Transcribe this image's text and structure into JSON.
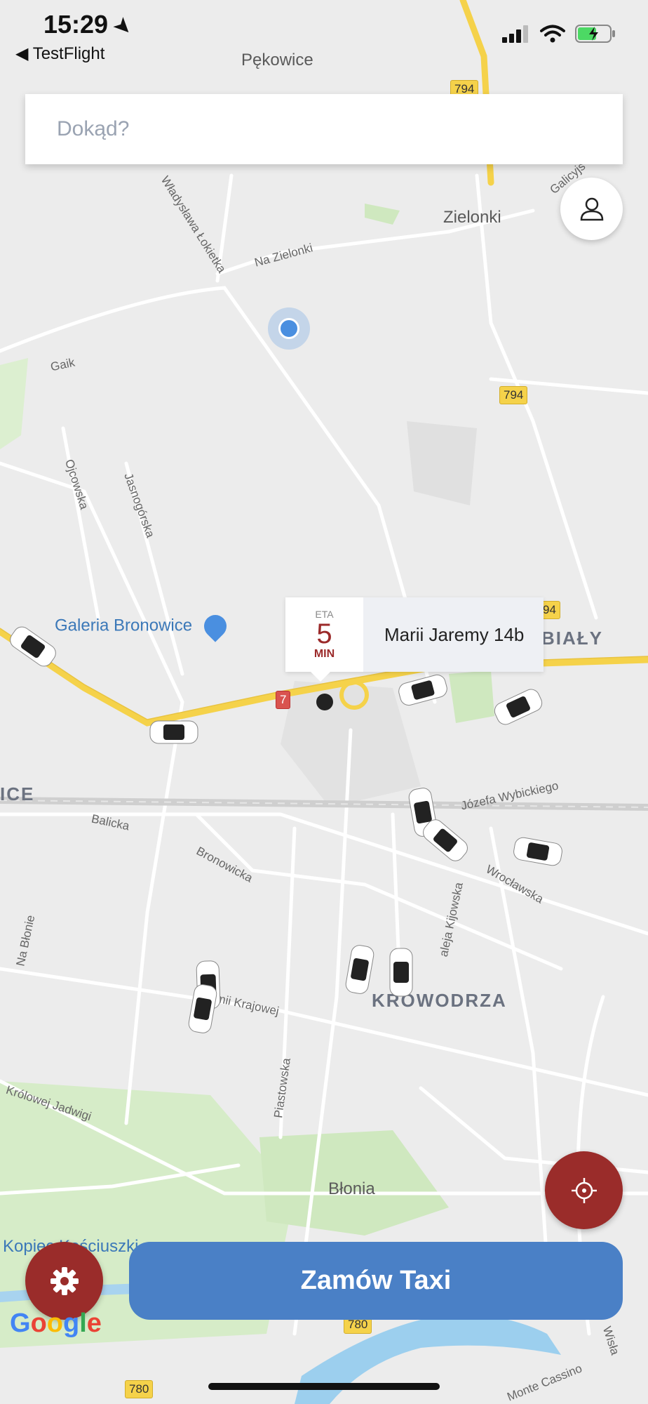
{
  "status_bar": {
    "time": "15:29",
    "back_app": "◀ TestFlight"
  },
  "search": {
    "placeholder": "Dokąd?"
  },
  "map": {
    "place_labels": {
      "pekowice": "Pękowice",
      "zielonki": "Zielonki",
      "bialy": "BIAŁY",
      "ice": "ICE",
      "krowodrza": "KROWODRZA",
      "blonia": "Błonia",
      "kopiec": "Kopiec Kościuszki",
      "galeria": "Galeria Bronowice"
    },
    "road_labels": {
      "lokietka": "Władysława Łokietka",
      "na_zielonki": "Na Zielonki",
      "gaik": "Gaik",
      "ojcowska": "Ojcowska",
      "jasnogorska": "Jasnogórska",
      "galicyjska": "Galicyjs",
      "balicka": "Balicka",
      "bronowicka": "Bronowicka",
      "wybickiego": "Józefa Wybickiego",
      "wroclawska": "Wrocławska",
      "kijowska": "aleja Kijowska",
      "krajowej": "Armii Krajowej",
      "na_blonie": "Na Błonie",
      "piastowska": "Piastowska",
      "krolowej": "Królowej Jadwigi",
      "wisla": "Wisła",
      "cassino": "Monte Cassino"
    },
    "route_shields": {
      "r794_top": "794",
      "r794_mid": "794",
      "r794_right": "94",
      "r7": "7",
      "r780_a": "780",
      "r780_b": "780"
    },
    "vehicle_count": 12
  },
  "eta": {
    "label": "ETA",
    "minutes": "5",
    "unit": "MIN",
    "address": "Marii Jaremy 14b"
  },
  "buttons": {
    "order": "Zamów Taxi"
  },
  "attribution": {
    "google": [
      "G",
      "o",
      "o",
      "g",
      "l",
      "e"
    ]
  },
  "colors": {
    "accent_red": "#9a2c2a",
    "primary_blue": "#4a80c6",
    "road_yellow": "#f5d24a"
  }
}
